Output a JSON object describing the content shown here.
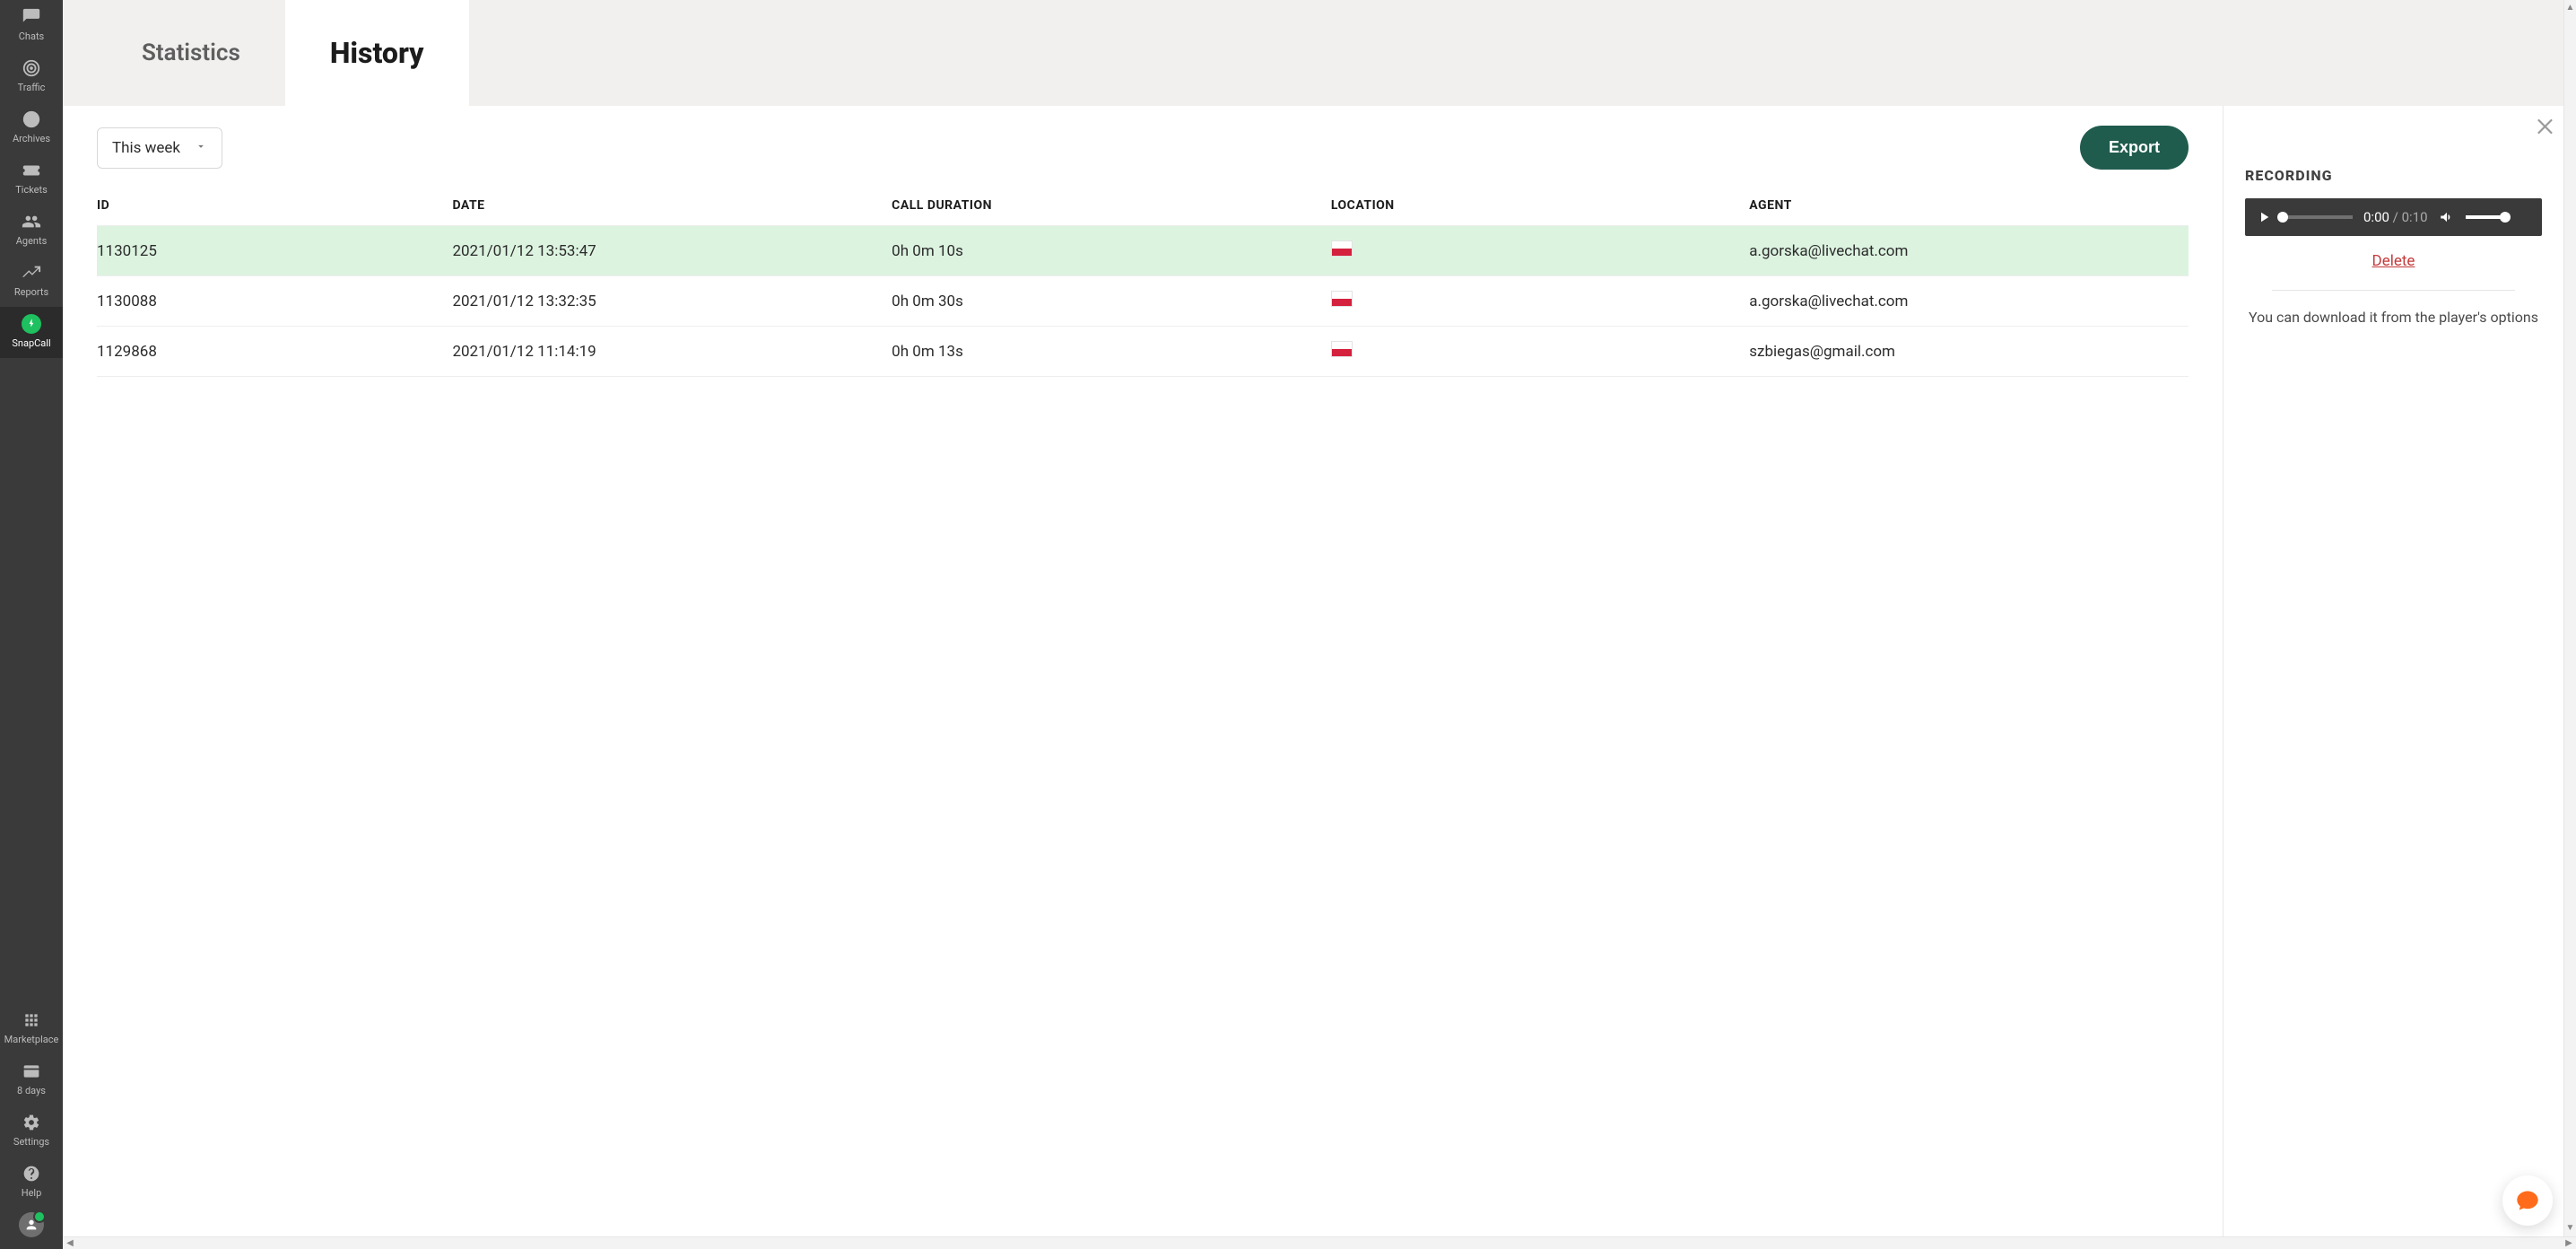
{
  "sidebar": {
    "items_top": [
      {
        "key": "chats",
        "label": "Chats"
      },
      {
        "key": "traffic",
        "label": "Traffic"
      },
      {
        "key": "archives",
        "label": "Archives"
      },
      {
        "key": "tickets",
        "label": "Tickets"
      },
      {
        "key": "agents",
        "label": "Agents"
      },
      {
        "key": "reports",
        "label": "Reports"
      },
      {
        "key": "snapcall",
        "label": "SnapCall"
      }
    ],
    "items_bottom": [
      {
        "key": "marketplace",
        "label": "Marketplace"
      },
      {
        "key": "days",
        "label": "8 days"
      },
      {
        "key": "settings",
        "label": "Settings"
      },
      {
        "key": "help",
        "label": "Help"
      }
    ],
    "active": "snapcall"
  },
  "tabs": {
    "items": [
      {
        "key": "statistics",
        "label": "Statistics"
      },
      {
        "key": "history",
        "label": "History"
      }
    ],
    "active": "history"
  },
  "toolbar": {
    "range_label": "This week",
    "export_label": "Export"
  },
  "table": {
    "columns": [
      "ID",
      "DATE",
      "CALL DURATION",
      "LOCATION",
      "AGENT"
    ],
    "rows": [
      {
        "id": "1130125",
        "date": "2021/01/12 13:53:47",
        "duration": "0h 0m 10s",
        "country": "PL",
        "agent": "a.gorska@livechat.com",
        "selected": true
      },
      {
        "id": "1130088",
        "date": "2021/01/12 13:32:35",
        "duration": "0h 0m 30s",
        "country": "PL",
        "agent": "a.gorska@livechat.com",
        "selected": false
      },
      {
        "id": "1129868",
        "date": "2021/01/12 11:14:19",
        "duration": "0h 0m 13s",
        "country": "PL",
        "agent": "szbiegas@gmail.com",
        "selected": false
      }
    ]
  },
  "panel": {
    "title": "RECORDING",
    "current_time": "0:00",
    "total_time": "0:10",
    "delete_label": "Delete",
    "hint": "You can download it from the player's options"
  }
}
